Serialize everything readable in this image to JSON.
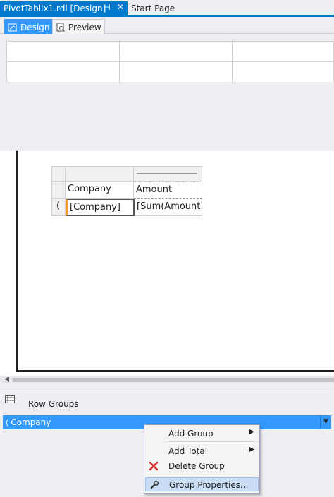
{
  "tabs": {
    "active_title": "PivotTablix1.rdl [Design]",
    "pin_glyph": "⊣",
    "close_glyph": "✕",
    "inactive_title": "Start Page"
  },
  "view_tabs": {
    "design_label": "Design",
    "preview_label": "Preview"
  },
  "tablix": {
    "header_company": "Company",
    "header_amount": "Amount",
    "row_company": "[Company]",
    "row_amount": "[Sum(Amount)]",
    "row_handle": "("
  },
  "groups": {
    "pane_label": "Row Groups",
    "group_name": "Company",
    "group_bracket": "(",
    "dropdown_glyph": "▼"
  },
  "context_menu": {
    "items": [
      {
        "label": "Add Group",
        "has_submenu": true
      },
      {
        "label": "Add Total",
        "has_submenu": true
      },
      {
        "label": "Delete Group",
        "has_submenu": false
      },
      {
        "label": "Group Properties...",
        "has_submenu": false
      }
    ],
    "submenu_glyph": "▶"
  },
  "colors": {
    "accent": "#007acc",
    "selection": "#3399ff",
    "menu_hover": "#c9def5",
    "delete_icon": "#d32f2f"
  }
}
